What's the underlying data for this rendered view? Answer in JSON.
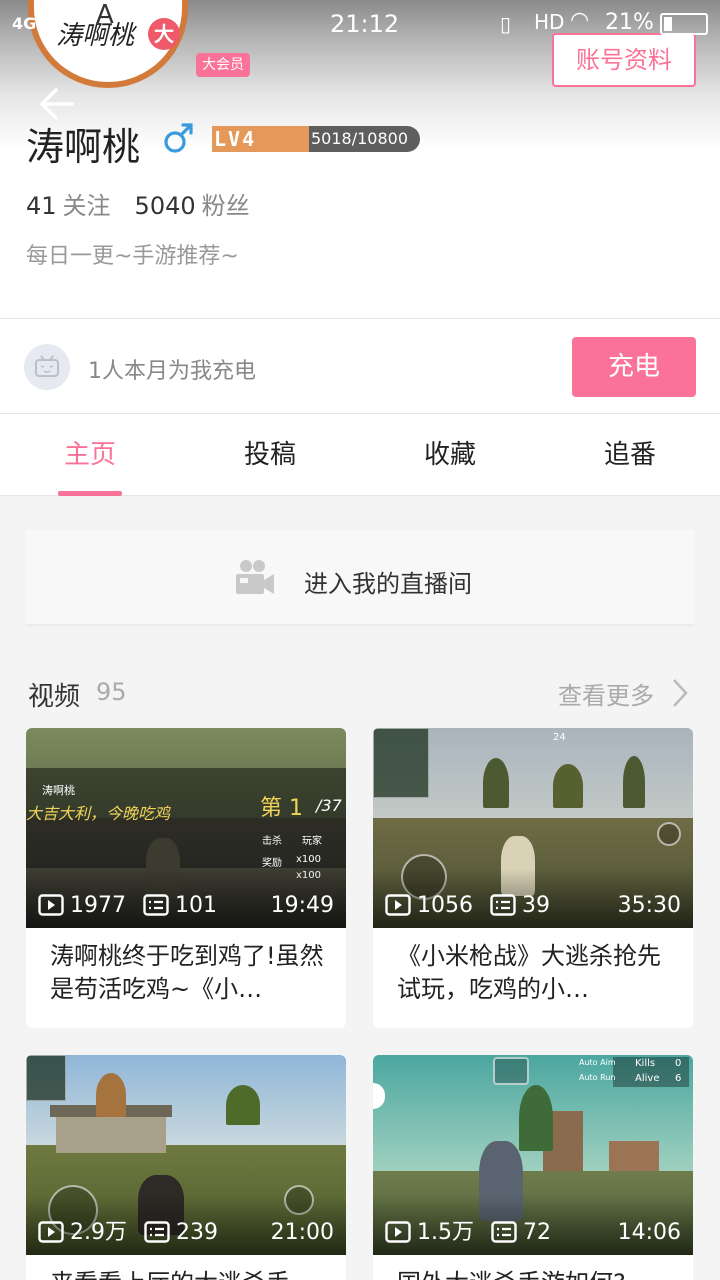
{
  "status_bar": {
    "network": "4G",
    "time": "21:12",
    "hd": "HD",
    "battery_percent": "21%"
  },
  "header": {
    "avatar_art_text": "涛啊桃",
    "avatar_big_badge": "大",
    "vip_badge": "大会员",
    "account_button": "账号资料",
    "username": "涛啊桃",
    "gender_symbol": "♂",
    "level": {
      "tag": "LV4",
      "exp_text": "5018/10800",
      "progress": 0.4646
    },
    "following_count": "41",
    "following_label": "关注",
    "fans_count": "5040",
    "fans_label": "粉丝",
    "signature": "每日一更~手游推荐~"
  },
  "charge": {
    "text": "1人本月为我充电",
    "button": "充电"
  },
  "tabs": [
    {
      "label": "主页",
      "active": true
    },
    {
      "label": "投稿",
      "active": false
    },
    {
      "label": "收藏",
      "active": false
    },
    {
      "label": "追番",
      "active": false
    }
  ],
  "live_entry": {
    "label": "进入我的直播间"
  },
  "videos_section": {
    "title": "视频",
    "count": "95",
    "more": "查看更多"
  },
  "videos": [
    {
      "plays": "1977",
      "danmaku": "101",
      "duration": "19:49",
      "title": "涛啊桃终于吃到鸡了!虽然是苟活吃鸡~《小…",
      "overlay": {
        "channel": "涛啊桃",
        "slogan": "大吉大利，今晚吃鸡",
        "rank": "第 1",
        "rank_total": "/37",
        "kills": "击杀",
        "players": "玩家",
        "reward": "奖励",
        "x1": "x100",
        "x2": "x100"
      }
    },
    {
      "plays": "1056",
      "danmaku": "39",
      "duration": "35:30",
      "title": "《小米枪战》大逃杀抢先试玩，吃鸡的小…",
      "overlay": {
        "alive": "24"
      }
    },
    {
      "plays": "2.9万",
      "danmaku": "239",
      "duration": "21:00",
      "title": "来看看上厅的大逃杀手…",
      "overlay": {}
    },
    {
      "plays": "1.5万",
      "danmaku": "72",
      "duration": "14:06",
      "title": "国外大逃杀手游如何?…",
      "overlay": {
        "hud_kills_label": "Kills",
        "hud_kills_value": "0",
        "hud_alive_label": "Alive",
        "hud_alive_value": "6",
        "auto_aim": "Auto Aim",
        "auto_run": "Auto Run"
      }
    }
  ],
  "colors": {
    "accent": "#fb7299",
    "level_fill": "#f3a05a",
    "gender_blue": "#3a9bdc"
  }
}
